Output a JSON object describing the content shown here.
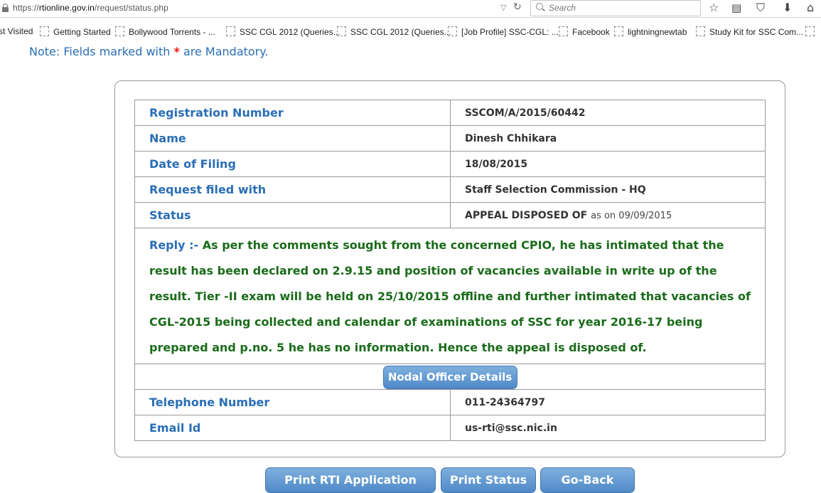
{
  "browser": {
    "url_prefix": "https://",
    "url_host": "rtionline.gov.in",
    "url_path": "/request/status.php",
    "search_placeholder": "Search",
    "bookmarks": [
      "st Visited",
      "Getting Started",
      "Bollywood Torrents - ...",
      "SSC CGL 2012 (Queries...",
      "SSC CGL 2012 (Queries...",
      "[Job Profile] SSC-CGL: ...",
      "Facebook",
      "lightningnewtab",
      "Study Kit for SSC Com..."
    ]
  },
  "note": {
    "prefix": "Note: Fields marked with",
    "star": "*",
    "suffix": "are Mandatory."
  },
  "details": {
    "registration_label": "Registration Number",
    "registration_value": "SSCOM/A/2015/60442",
    "name_label": "Name",
    "name_value": "Dinesh Chhikara",
    "date_label": "Date of Filing",
    "date_value": "18/08/2015",
    "filed_with_label": "Request filed with",
    "filed_with_value": "Staff Selection Commission - HQ",
    "status_label": "Status",
    "status_value": "APPEAL DISPOSED OF",
    "status_asof": "as on 09/09/2015",
    "reply_label": "Reply :-",
    "reply_text": "As per the comments sought from the concerned CPIO, he has intimated that the result has been declared on 2.9.15 and position of vacancies available in write up of the result. Tier -II exam will be held on 25/10/2015 offline and further intimated that vacancies of CGL-2015 being collected and calendar of examinations of SSC for year 2016-17 being prepared and p.no. 5 he has no information. Hence the appeal is disposed of.",
    "nodal_button": "Nodal Officer Details",
    "telephone_label": "Telephone Number",
    "telephone_value": "011-24364797",
    "email_label": "Email Id",
    "email_value": "us-rti@ssc.nic.in"
  },
  "actions": {
    "print_application": "Print RTI Application",
    "print_status": "Print Status",
    "go_back": "Go-Back"
  },
  "colors": {
    "label_blue": "#2a6eb5",
    "reply_green": "#1a6b1a",
    "button_blue": "#5b94cf",
    "mandatory_red": "#e11"
  }
}
